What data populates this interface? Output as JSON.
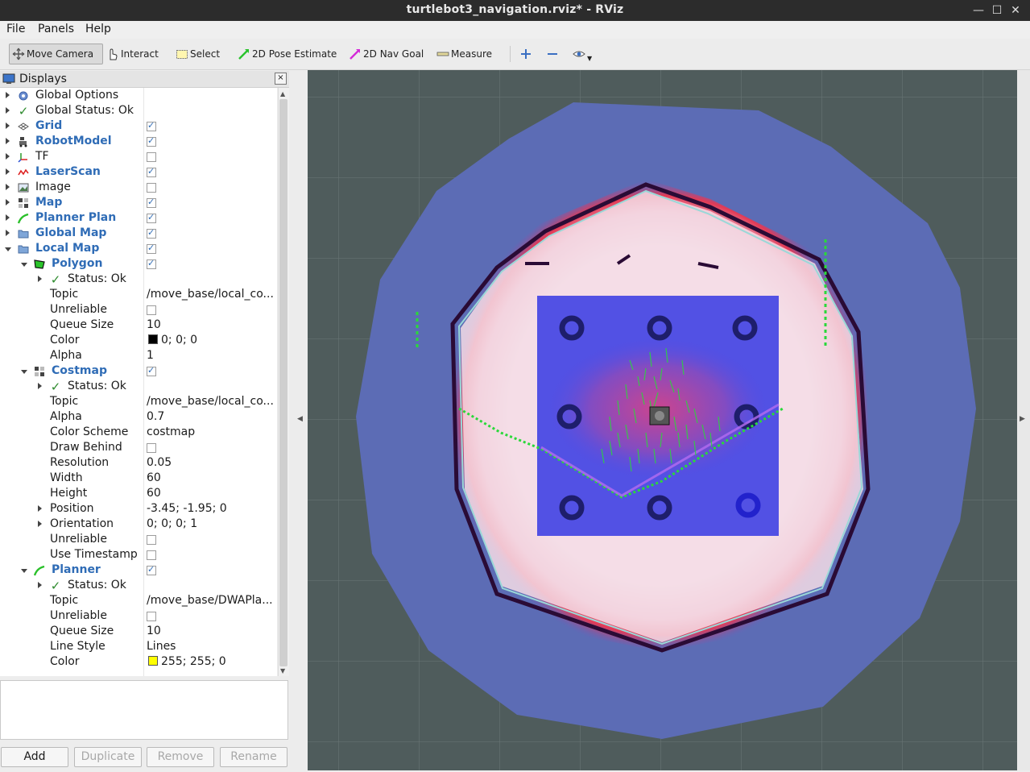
{
  "window": {
    "title": "turtlebot3_navigation.rviz* - RViz",
    "minimize_glyph": "—",
    "maximize_glyph": "☐",
    "close_glyph": "✕"
  },
  "menu": [
    "File",
    "Panels",
    "Help"
  ],
  "toolbar": {
    "move_camera": "Move Camera",
    "interact": "Interact",
    "select": "Select",
    "pose_estimate": "2D Pose Estimate",
    "nav_goal": "2D Nav Goal",
    "measure": "Measure"
  },
  "panel": {
    "title": "Displays",
    "close_glyph": "×"
  },
  "displays": {
    "global_options": "Global Options",
    "global_status": "Global Status: Ok",
    "grid": "Grid",
    "robot_model": "RobotModel",
    "tf": "TF",
    "laser_scan": "LaserScan",
    "image": "Image",
    "map": "Map",
    "planner_plan": "Planner Plan",
    "global_map": "Global Map",
    "local_map": "Local Map",
    "polygon": {
      "name": "Polygon",
      "status": "Status: Ok",
      "topic_label": "Topic",
      "topic": "/move_base/local_co...",
      "unreliable_label": "Unreliable",
      "queue_label": "Queue Size",
      "queue": "10",
      "color_label": "Color",
      "color": "0; 0; 0",
      "alpha_label": "Alpha",
      "alpha": "1"
    },
    "costmap": {
      "name": "Costmap",
      "status": "Status: Ok",
      "topic_label": "Topic",
      "topic": "/move_base/local_co...",
      "alpha_label": "Alpha",
      "alpha": "0.7",
      "scheme_label": "Color Scheme",
      "scheme": "costmap",
      "draw_behind_label": "Draw Behind",
      "resolution_label": "Resolution",
      "resolution": "0.05",
      "width_label": "Width",
      "width": "60",
      "height_label": "Height",
      "height": "60",
      "position_label": "Position",
      "position": "-3.45; -1.95; 0",
      "orientation_label": "Orientation",
      "orientation": "0; 0; 0; 1",
      "unreliable_label": "Unreliable",
      "timestamp_label": "Use Timestamp"
    },
    "planner": {
      "name": "Planner",
      "status": "Status: Ok",
      "topic_label": "Topic",
      "topic": "/move_base/DWAPla...",
      "unreliable_label": "Unreliable",
      "queue_label": "Queue Size",
      "queue": "10",
      "line_style_label": "Line Style",
      "line_style": "Lines",
      "color_label": "Color",
      "color": "255; 255; 0"
    }
  },
  "buttons": {
    "add": "Add",
    "duplicate": "Duplicate",
    "remove": "Remove",
    "rename": "Rename"
  },
  "colors": {
    "viewport_bg": "#4f5c5c",
    "outer_costmap": "#5c6cb5",
    "inflation_inner": "#f3dde6",
    "inflation_edge": "#e23a55",
    "wall": "#2a0b35",
    "local_costmap": "#4949e4",
    "path": "#2ad83a",
    "link_blue": "#2f6cb6"
  }
}
